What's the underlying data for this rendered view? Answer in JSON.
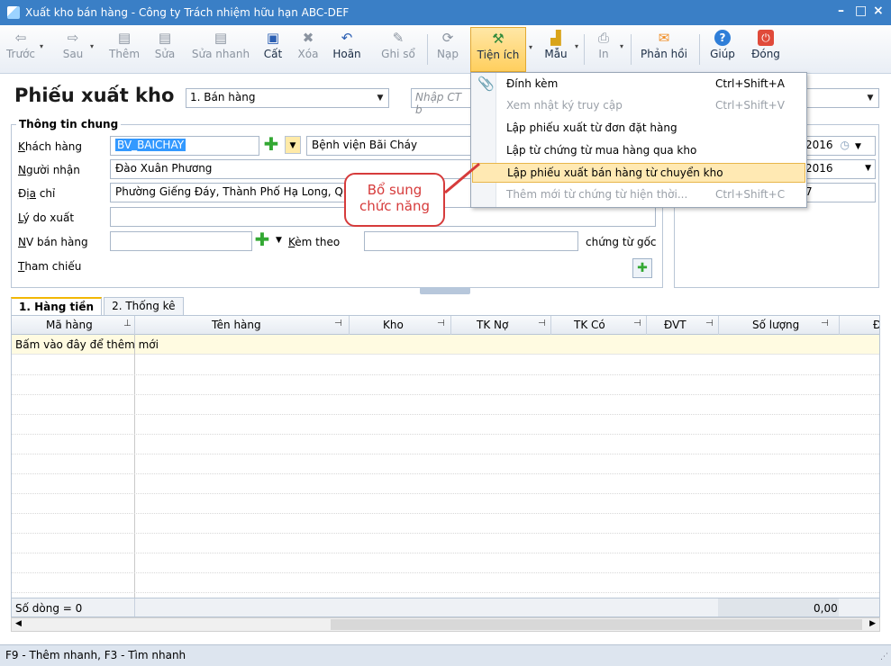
{
  "window": {
    "title": "Xuất kho bán hàng - Công ty Trách nhiệm hữu hạn ABC-DEF",
    "controls": [
      "–",
      "□",
      "×"
    ]
  },
  "toolbar": {
    "items": [
      {
        "label": "Trước",
        "icon": "arrow-left-icon",
        "glyph": "⇦",
        "enabled": false
      },
      {
        "label": "Sau",
        "icon": "arrow-right-icon",
        "glyph": "⇨",
        "enabled": false
      },
      {
        "label": "Thêm",
        "icon": "add-doc-icon",
        "glyph": "▤",
        "enabled": false
      },
      {
        "label": "Sửa",
        "icon": "edit-doc-icon",
        "glyph": "▤",
        "enabled": false
      },
      {
        "label": "Sửa nhanh",
        "icon": "quick-edit-icon",
        "glyph": "▤",
        "enabled": false
      },
      {
        "label": "Cất",
        "icon": "save-icon",
        "glyph": "💾",
        "enabled": true
      },
      {
        "label": "Xóa",
        "icon": "delete-icon",
        "glyph": "✖",
        "enabled": false
      },
      {
        "label": "Hoãn",
        "icon": "undo-icon",
        "glyph": "↶",
        "enabled": true
      },
      {
        "label": "Ghi sổ",
        "icon": "post-icon",
        "glyph": "✎",
        "enabled": false
      },
      {
        "label": "Nạp",
        "icon": "reload-icon",
        "glyph": "⟳",
        "enabled": false
      },
      {
        "label": "Tiện ích",
        "icon": "tools-icon",
        "glyph": "⚒",
        "enabled": true
      },
      {
        "label": "Mẫu",
        "icon": "template-icon",
        "glyph": "▟",
        "enabled": true
      },
      {
        "label": "In",
        "icon": "print-icon",
        "glyph": "⎙",
        "enabled": false
      },
      {
        "label": "Phản hồi",
        "icon": "feedback-icon",
        "glyph": "✉",
        "enabled": true
      },
      {
        "label": "Giúp",
        "icon": "help-icon",
        "glyph": "?",
        "enabled": true
      },
      {
        "label": "Đóng",
        "icon": "close-icon",
        "glyph": "⏻",
        "enabled": true
      }
    ]
  },
  "header": {
    "page_title": "Phiếu xuất kho",
    "type_select": "1. Bán hàng",
    "ref_placeholder": "Nhập CT b"
  },
  "general": {
    "group_title": "Thông tin chung",
    "customer_label": "Khách hàng",
    "customer_code": "BV_BAICHAY",
    "customer_name": "Bệnh viện Bãi Cháy",
    "receiver_label": "Người nhận",
    "receiver_value": "Đào Xuân Phương",
    "address_label": "Địa chỉ",
    "address_value": "Phường Giếng Đáy, Thành Phố Hạ Long, Quản",
    "reason_label": "Lý do xuất",
    "reason_value": "",
    "sales_label": "NV bán hàng",
    "sales_value": "",
    "attach_label": "Kèm theo",
    "attach_value": "",
    "attach_suffix": "chứng từ gốc",
    "ref_label": "Tham chiếu"
  },
  "right_panel": {
    "date1": "2016",
    "date2": "2016",
    "number": "7"
  },
  "tabs": [
    {
      "label": "1. Hàng tiền",
      "active": true
    },
    {
      "label": "2. Thống kê",
      "active": false
    }
  ],
  "grid": {
    "columns": [
      "Mã hàng",
      "Tên hàng",
      "Kho",
      "TK Nợ",
      "TK Có",
      "ĐVT",
      "Số lượng",
      "Đ"
    ],
    "new_row_text": "Bấm vào đây để thêm mới",
    "footer_count": "Số dòng = 0",
    "footer_total": "0,00"
  },
  "menu": {
    "items": [
      {
        "label": "Đính kèm",
        "shortcut": "Ctrl+Shift+A",
        "enabled": true,
        "icon": "paperclip-icon"
      },
      {
        "label": "Xem nhật ký truy cập",
        "shortcut": "Ctrl+Shift+V",
        "enabled": false
      },
      {
        "label": "Lập phiếu xuất từ đơn đặt hàng",
        "shortcut": "",
        "enabled": true
      },
      {
        "label": "Lập từ chứng từ mua hàng qua kho",
        "shortcut": "",
        "enabled": true
      },
      {
        "label": "Lập phiếu xuất bán hàng từ chuyển kho",
        "shortcut": "",
        "enabled": true,
        "highlighted": true
      },
      {
        "label": "Thêm mới từ chứng từ hiện thời...",
        "shortcut": "Ctrl+Shift+C",
        "enabled": false
      }
    ]
  },
  "callout": {
    "line1": "Bổ sung",
    "line2": "chức năng"
  },
  "statusbar": {
    "text": "F9 - Thêm nhanh, F3 - Tìm nhanh"
  },
  "colors": {
    "titlebar": "#3a7fc6",
    "highlight": "#ffe9b3",
    "callout": "#d63b3b"
  }
}
